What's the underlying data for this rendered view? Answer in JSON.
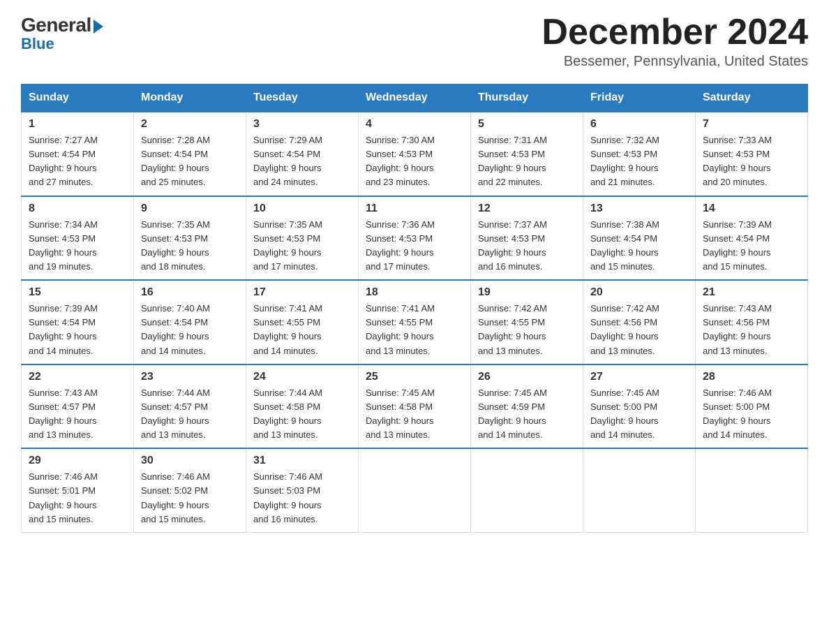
{
  "logo": {
    "general": "General",
    "blue": "Blue"
  },
  "header": {
    "month": "December 2024",
    "location": "Bessemer, Pennsylvania, United States"
  },
  "weekdays": [
    "Sunday",
    "Monday",
    "Tuesday",
    "Wednesday",
    "Thursday",
    "Friday",
    "Saturday"
  ],
  "weeks": [
    [
      {
        "day": "1",
        "sunrise": "7:27 AM",
        "sunset": "4:54 PM",
        "daylight": "9 hours and 27 minutes."
      },
      {
        "day": "2",
        "sunrise": "7:28 AM",
        "sunset": "4:54 PM",
        "daylight": "9 hours and 25 minutes."
      },
      {
        "day": "3",
        "sunrise": "7:29 AM",
        "sunset": "4:54 PM",
        "daylight": "9 hours and 24 minutes."
      },
      {
        "day": "4",
        "sunrise": "7:30 AM",
        "sunset": "4:53 PM",
        "daylight": "9 hours and 23 minutes."
      },
      {
        "day": "5",
        "sunrise": "7:31 AM",
        "sunset": "4:53 PM",
        "daylight": "9 hours and 22 minutes."
      },
      {
        "day": "6",
        "sunrise": "7:32 AM",
        "sunset": "4:53 PM",
        "daylight": "9 hours and 21 minutes."
      },
      {
        "day": "7",
        "sunrise": "7:33 AM",
        "sunset": "4:53 PM",
        "daylight": "9 hours and 20 minutes."
      }
    ],
    [
      {
        "day": "8",
        "sunrise": "7:34 AM",
        "sunset": "4:53 PM",
        "daylight": "9 hours and 19 minutes."
      },
      {
        "day": "9",
        "sunrise": "7:35 AM",
        "sunset": "4:53 PM",
        "daylight": "9 hours and 18 minutes."
      },
      {
        "day": "10",
        "sunrise": "7:35 AM",
        "sunset": "4:53 PM",
        "daylight": "9 hours and 17 minutes."
      },
      {
        "day": "11",
        "sunrise": "7:36 AM",
        "sunset": "4:53 PM",
        "daylight": "9 hours and 17 minutes."
      },
      {
        "day": "12",
        "sunrise": "7:37 AM",
        "sunset": "4:53 PM",
        "daylight": "9 hours and 16 minutes."
      },
      {
        "day": "13",
        "sunrise": "7:38 AM",
        "sunset": "4:54 PM",
        "daylight": "9 hours and 15 minutes."
      },
      {
        "day": "14",
        "sunrise": "7:39 AM",
        "sunset": "4:54 PM",
        "daylight": "9 hours and 15 minutes."
      }
    ],
    [
      {
        "day": "15",
        "sunrise": "7:39 AM",
        "sunset": "4:54 PM",
        "daylight": "9 hours and 14 minutes."
      },
      {
        "day": "16",
        "sunrise": "7:40 AM",
        "sunset": "4:54 PM",
        "daylight": "9 hours and 14 minutes."
      },
      {
        "day": "17",
        "sunrise": "7:41 AM",
        "sunset": "4:55 PM",
        "daylight": "9 hours and 14 minutes."
      },
      {
        "day": "18",
        "sunrise": "7:41 AM",
        "sunset": "4:55 PM",
        "daylight": "9 hours and 13 minutes."
      },
      {
        "day": "19",
        "sunrise": "7:42 AM",
        "sunset": "4:55 PM",
        "daylight": "9 hours and 13 minutes."
      },
      {
        "day": "20",
        "sunrise": "7:42 AM",
        "sunset": "4:56 PM",
        "daylight": "9 hours and 13 minutes."
      },
      {
        "day": "21",
        "sunrise": "7:43 AM",
        "sunset": "4:56 PM",
        "daylight": "9 hours and 13 minutes."
      }
    ],
    [
      {
        "day": "22",
        "sunrise": "7:43 AM",
        "sunset": "4:57 PM",
        "daylight": "9 hours and 13 minutes."
      },
      {
        "day": "23",
        "sunrise": "7:44 AM",
        "sunset": "4:57 PM",
        "daylight": "9 hours and 13 minutes."
      },
      {
        "day": "24",
        "sunrise": "7:44 AM",
        "sunset": "4:58 PM",
        "daylight": "9 hours and 13 minutes."
      },
      {
        "day": "25",
        "sunrise": "7:45 AM",
        "sunset": "4:58 PM",
        "daylight": "9 hours and 13 minutes."
      },
      {
        "day": "26",
        "sunrise": "7:45 AM",
        "sunset": "4:59 PM",
        "daylight": "9 hours and 14 minutes."
      },
      {
        "day": "27",
        "sunrise": "7:45 AM",
        "sunset": "5:00 PM",
        "daylight": "9 hours and 14 minutes."
      },
      {
        "day": "28",
        "sunrise": "7:46 AM",
        "sunset": "5:00 PM",
        "daylight": "9 hours and 14 minutes."
      }
    ],
    [
      {
        "day": "29",
        "sunrise": "7:46 AM",
        "sunset": "5:01 PM",
        "daylight": "9 hours and 15 minutes."
      },
      {
        "day": "30",
        "sunrise": "7:46 AM",
        "sunset": "5:02 PM",
        "daylight": "9 hours and 15 minutes."
      },
      {
        "day": "31",
        "sunrise": "7:46 AM",
        "sunset": "5:03 PM",
        "daylight": "9 hours and 16 minutes."
      },
      null,
      null,
      null,
      null
    ]
  ],
  "labels": {
    "sunrise": "Sunrise:",
    "sunset": "Sunset:",
    "daylight": "Daylight:"
  }
}
